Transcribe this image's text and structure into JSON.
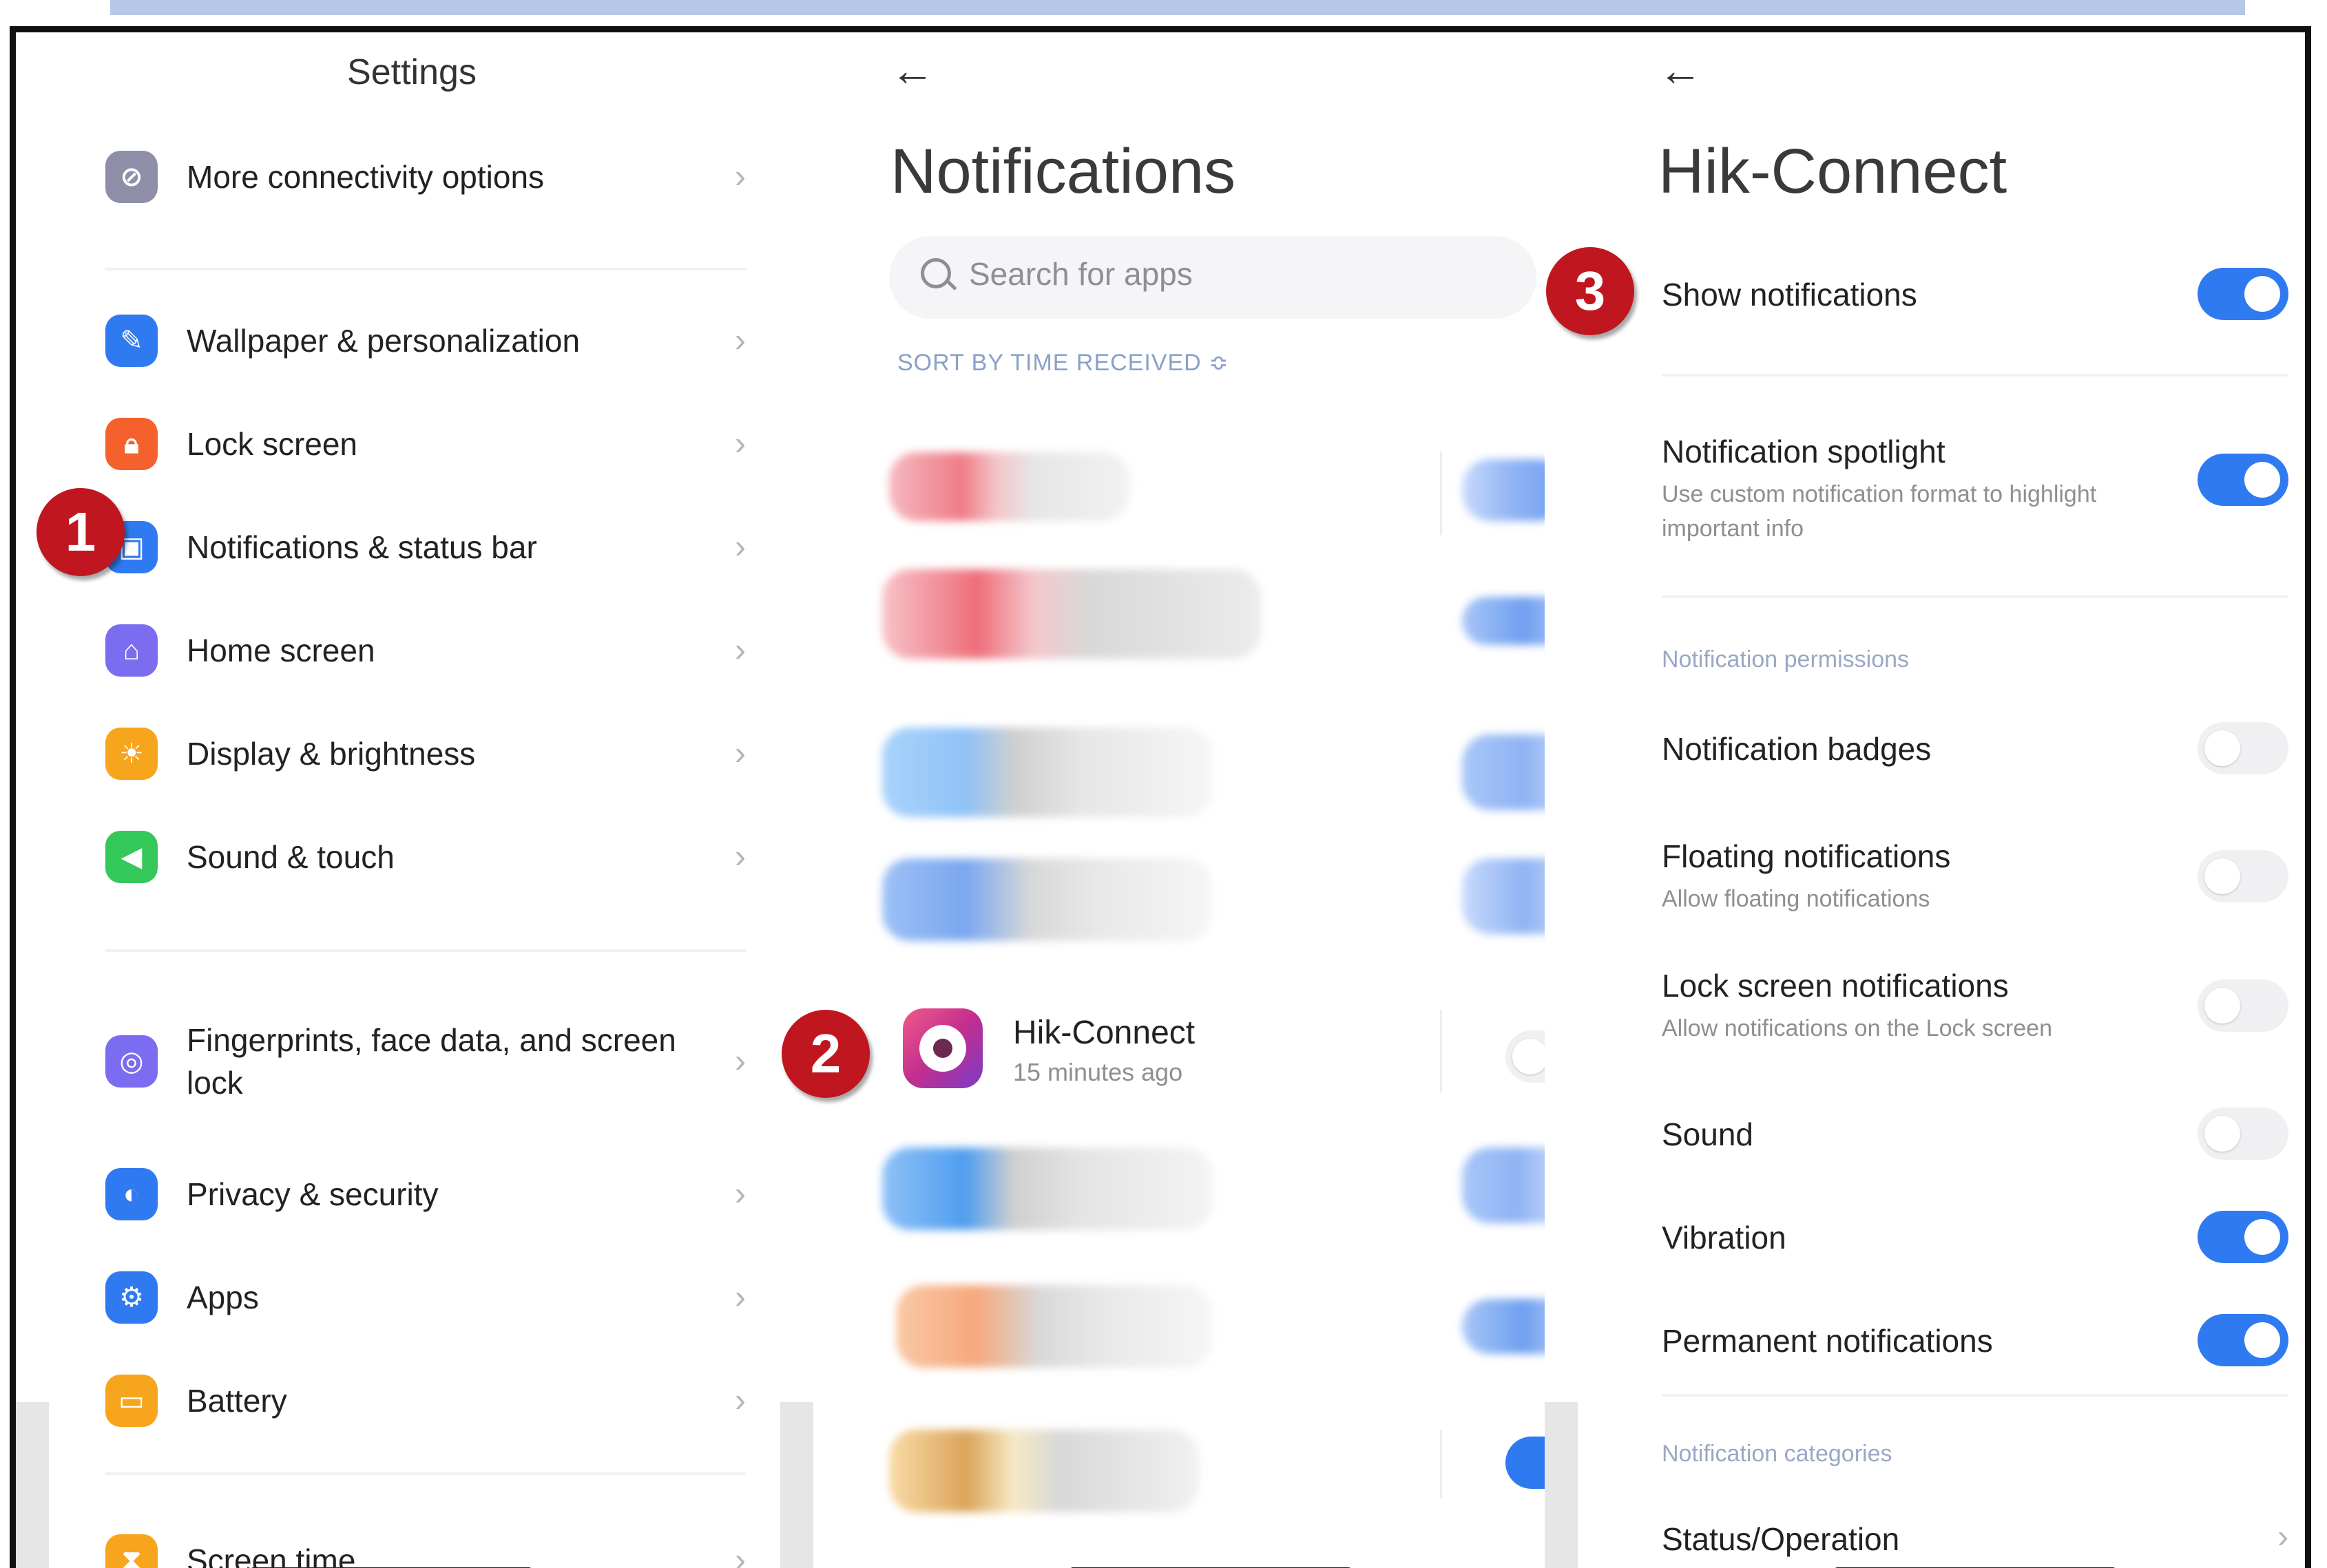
{
  "settings": {
    "title": "Settings",
    "items": [
      {
        "label": "More connectivity options",
        "icon": "link-icon",
        "color": "#8e8ea8"
      },
      {
        "label": "Wallpaper & personalization",
        "icon": "brush-icon",
        "color": "#2f7af0"
      },
      {
        "label": "Lock screen",
        "icon": "lock-icon",
        "color": "#f4612c"
      },
      {
        "label": "Notifications & status bar",
        "icon": "bell-icon",
        "color": "#2f7af0"
      },
      {
        "label": "Home screen",
        "icon": "home-icon",
        "color": "#7b6cf0"
      },
      {
        "label": "Display & brightness",
        "icon": "sun-icon",
        "color": "#f7a51c"
      },
      {
        "label": "Sound & touch",
        "icon": "speaker-icon",
        "color": "#34c759"
      },
      {
        "label": "Fingerprints, face data, and screen lock",
        "icon": "fingerprint-icon",
        "color": "#7b6cf0"
      },
      {
        "label": "Privacy & security",
        "icon": "shield-icon",
        "color": "#2f7af0"
      },
      {
        "label": "Apps",
        "icon": "apps-icon",
        "color": "#2f7af0"
      },
      {
        "label": "Battery",
        "icon": "battery-icon",
        "color": "#f7a51c"
      },
      {
        "label": "Screen time",
        "icon": "hourglass-icon",
        "color": "#f7a51c"
      }
    ]
  },
  "badges": {
    "one": "1",
    "two": "2",
    "three": "3"
  },
  "notifications": {
    "back": "←",
    "title": "Notifications",
    "search_placeholder": "Search for apps",
    "sort_label": "SORT BY TIME RECEIVED ≎",
    "highlight_app": {
      "name": "Hik-Connect",
      "time": "15 minutes ago",
      "enabled": false
    }
  },
  "app_settings": {
    "back": "←",
    "title": "Hik-Connect",
    "show_notifications": {
      "label": "Show notifications",
      "on": true
    },
    "spotlight": {
      "label": "Notification spotlight",
      "sub": "Use custom notification format to highlight important info",
      "on": true
    },
    "permissions_header": "Notification permissions",
    "badges": {
      "label": "Notification badges",
      "on": false
    },
    "floating": {
      "label": "Floating notifications",
      "sub": "Allow floating notifications",
      "on": false
    },
    "lock_screen": {
      "label": "Lock screen notifications",
      "sub": "Allow notifications on the Lock screen",
      "on": false
    },
    "sound": {
      "label": "Sound",
      "on": false
    },
    "vibration": {
      "label": "Vibration",
      "on": true
    },
    "permanent": {
      "label": "Permanent notifications",
      "on": true
    },
    "categories_header": "Notification categories",
    "status": {
      "label": "Status/Operation"
    }
  },
  "chevron": "›"
}
